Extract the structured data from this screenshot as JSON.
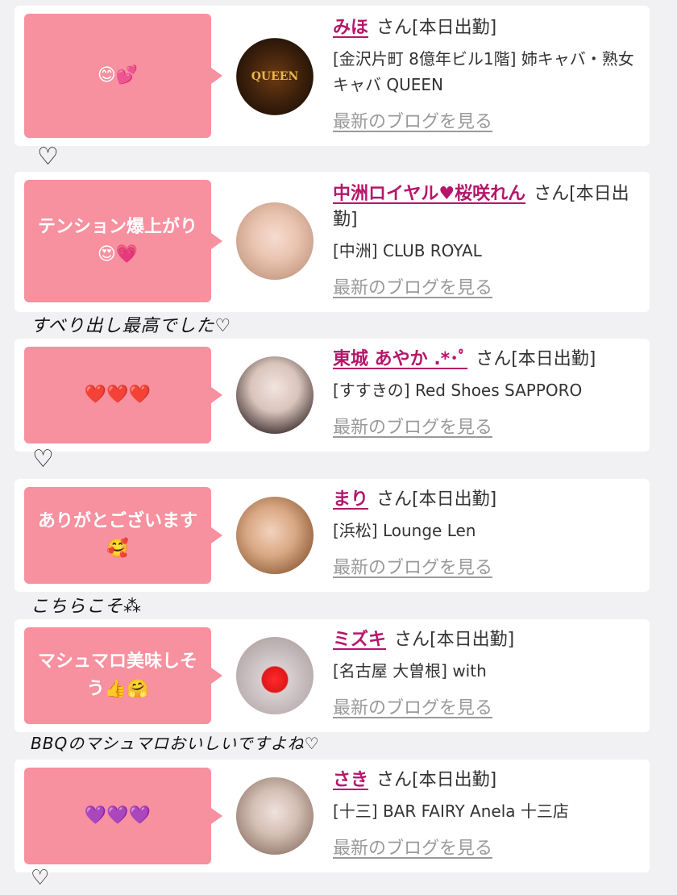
{
  "entries": [
    {
      "bubble": "😊💕",
      "name": "みほ",
      "suffix": "さん[本日出勤]",
      "shop": "[金沢片町 8億年ビル1階] 姉キャバ・熟女キャバ QUEEN",
      "link": "最新のブログを見る",
      "logo_text": "QUEEN"
    },
    {
      "bubble": "テンション爆上がり😍💗",
      "name": "中洲ロイヤル♥桜咲れん",
      "suffix": "さん[本日出勤]",
      "shop": "[中洲] CLUB ROYAL",
      "link": "最新のブログを見る"
    },
    {
      "bubble": "❤️❤️❤️",
      "name": "東城 あやか .*･ﾟ",
      "suffix": "さん[本日出勤]",
      "shop": "[すすきの] Red Shoes SAPPORO",
      "link": "最新のブログを見る"
    },
    {
      "bubble": "ありがとございます🥰",
      "name": "まり",
      "suffix": "さん[本日出勤]",
      "shop": "[浜松] Lounge Len",
      "link": "最新のブログを見る"
    },
    {
      "bubble": "マシュマロ美味しそう👍🤗",
      "name": "ミズキ",
      "suffix": "さん[本日出勤]",
      "shop": "[名古屋 大曽根] with",
      "link": "最新のブログを見る"
    },
    {
      "bubble": "💜💜💜",
      "name": "さき",
      "suffix": "さん[本日出勤]",
      "shop": "[十三] BAR FAIRY Anela 十三店",
      "link": "最新のブログを見る"
    }
  ],
  "notes": {
    "n1": "♡",
    "n2": "すべり出し最高でした♡",
    "n3": "♡",
    "n4": "こちらこそ⁂",
    "n5": "BBQのマシュマロおいしいですよね♡",
    "n6": "♡"
  }
}
